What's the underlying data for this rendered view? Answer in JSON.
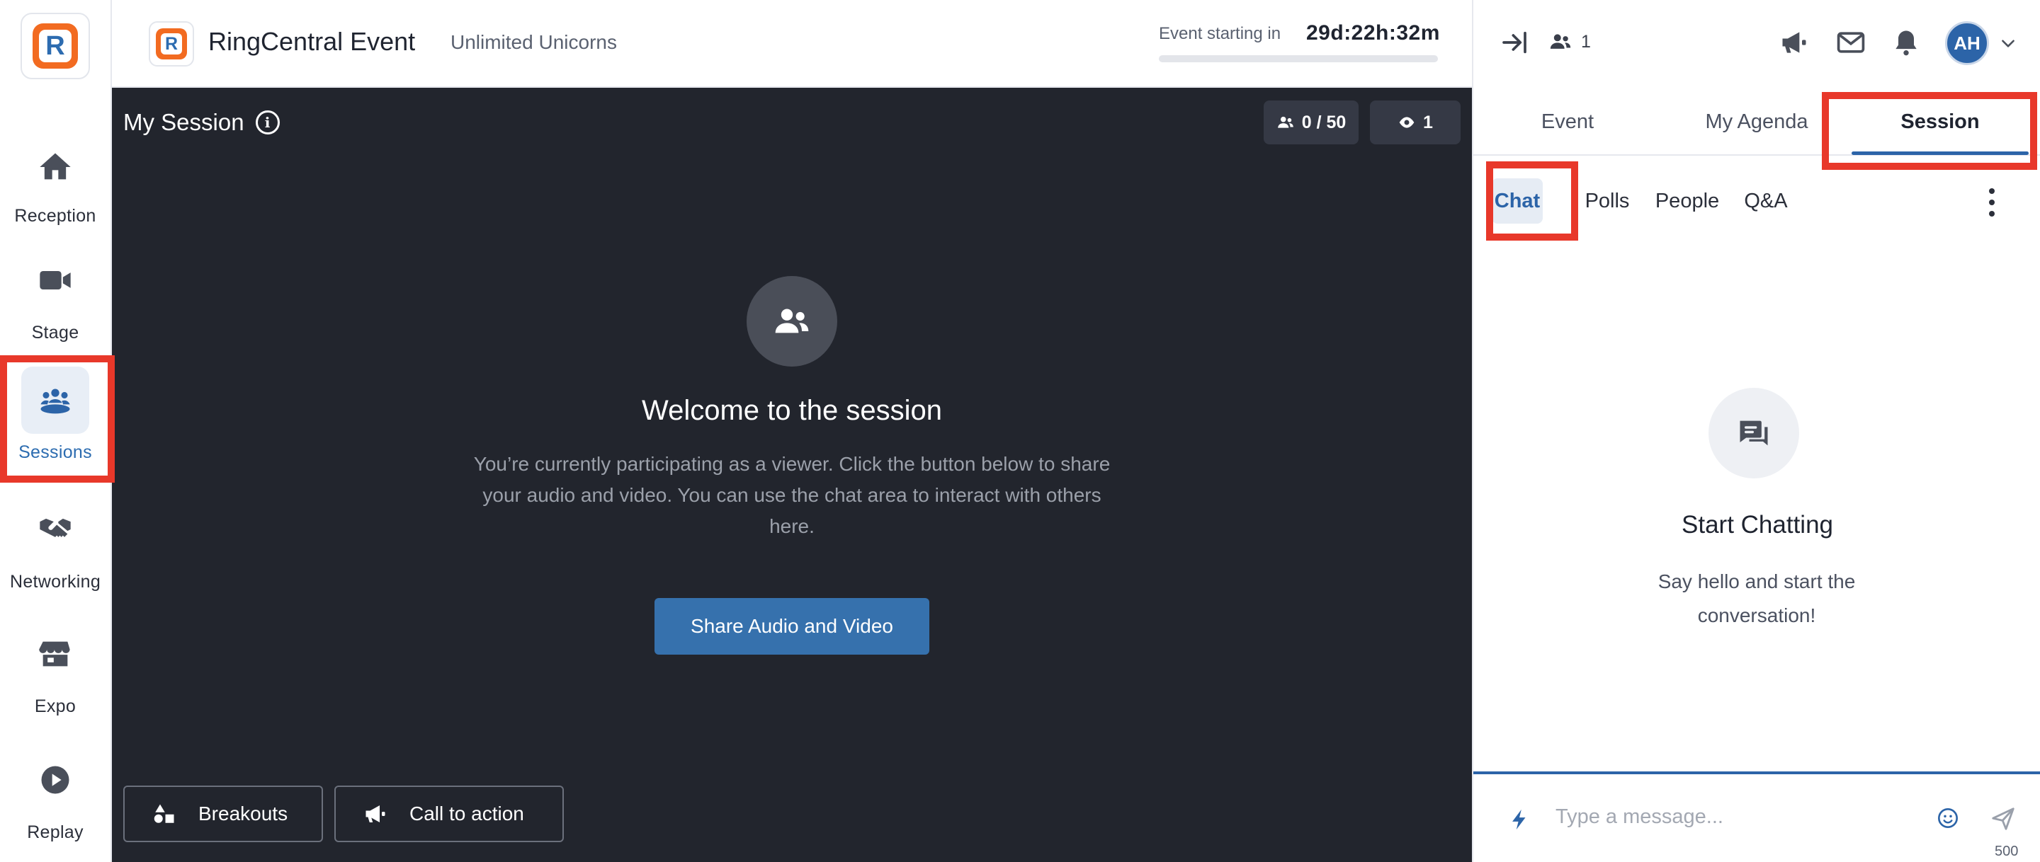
{
  "nav": {
    "items": [
      {
        "label": "Reception",
        "icon": "home-icon"
      },
      {
        "label": "Stage",
        "icon": "video-camera-icon"
      },
      {
        "label": "Sessions",
        "icon": "sessions-group-icon",
        "active": true
      },
      {
        "label": "Networking",
        "icon": "handshake-icon"
      },
      {
        "label": "Expo",
        "icon": "storefront-icon"
      },
      {
        "label": "Replay",
        "icon": "play-circle-icon"
      }
    ]
  },
  "header": {
    "brand_title": "RingCentral Event",
    "event_name": "Unlimited Unicorns",
    "countdown_label": "Event starting in",
    "countdown_value": "29d:22h:32m"
  },
  "stage": {
    "session_title": "My Session",
    "attendees_pill": "0 / 50",
    "viewers_pill": "1",
    "welcome_title": "Welcome to the session",
    "welcome_text": "You’re currently participating as a viewer. Click the button below to share your audio and video. You can use the chat area to interact with others here.",
    "share_button": "Share Audio and Video",
    "breakouts_button": "Breakouts",
    "cta_button": "Call to action"
  },
  "panel": {
    "online_count": "1",
    "avatar_initials": "AH",
    "tabs": [
      {
        "label": "Event"
      },
      {
        "label": "My Agenda"
      },
      {
        "label": "Session",
        "active": true
      }
    ],
    "subtabs": [
      {
        "label": "Chat",
        "active": true
      },
      {
        "label": "Polls"
      },
      {
        "label": "People"
      },
      {
        "label": "Q&A"
      }
    ],
    "empty_title": "Start Chatting",
    "empty_text": "Say hello and start the conversation!",
    "message_placeholder": "Type a message...",
    "char_limit": "500"
  },
  "colors": {
    "accent": "#2c64a8",
    "stage_bg": "#22252d",
    "highlight": "#e8382a",
    "brand_orange": "#f26b21"
  }
}
